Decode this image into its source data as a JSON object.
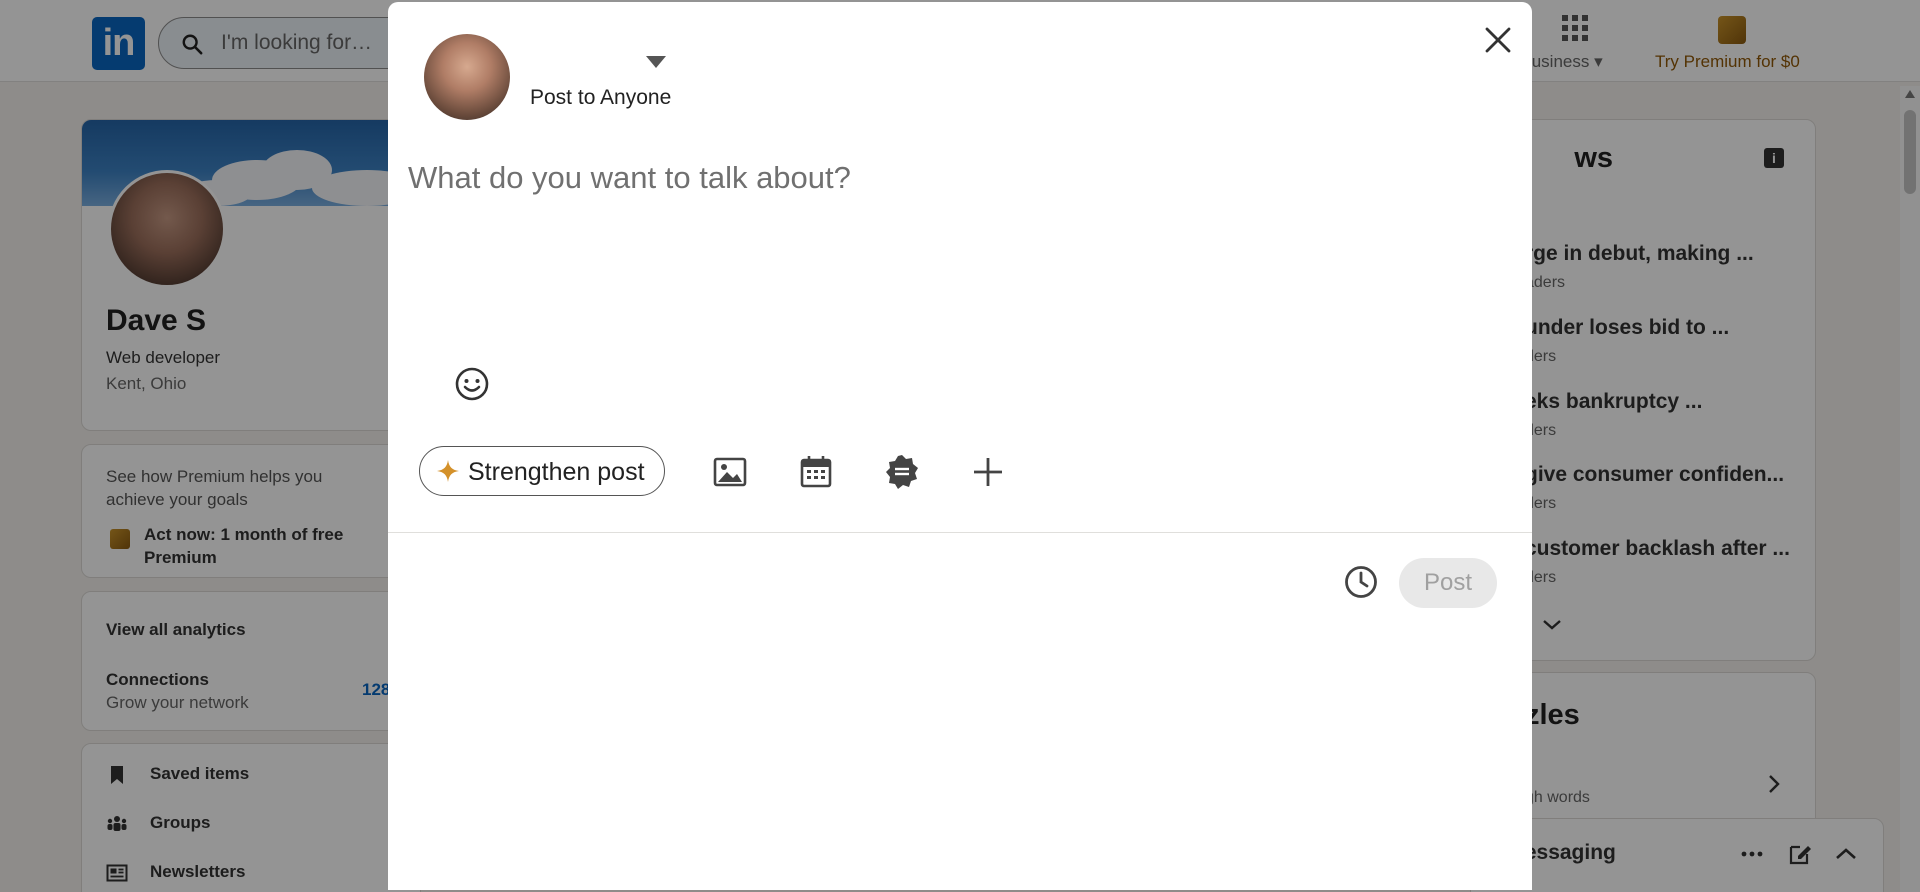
{
  "header": {
    "search_placeholder": "I'm looking for…",
    "business_label": "r Business",
    "premium_label": "Try Premium for $0"
  },
  "profile": {
    "name": "Dave S",
    "headline": "Web developer",
    "location": "Kent, Ohio"
  },
  "promo": {
    "text": "See how Premium helps you achieve your goals",
    "cta": "Act now: 1 month of free Premium"
  },
  "analytics": {
    "view_all": "View all analytics",
    "connections_label": "Connections",
    "connections_sub": "Grow your network",
    "connections_count": "128"
  },
  "nav": {
    "items": [
      {
        "label": "Saved items"
      },
      {
        "label": "Groups"
      },
      {
        "label": "Newsletters"
      }
    ]
  },
  "news": {
    "title": "ws",
    "items": [
      {
        "headline": "rge in debut, making ...",
        "readers": "aders"
      },
      {
        "headline": "under loses bid to ...",
        "readers": "ders"
      },
      {
        "headline": "eks bankruptcy ...",
        "readers": "ders"
      },
      {
        "headline": "give consumer confiden...",
        "readers": "ders"
      },
      {
        "headline": "customer backlash after ...",
        "readers": "ders"
      }
    ]
  },
  "puzzles": {
    "title": "zles",
    "subtitle": "gh words"
  },
  "messaging": {
    "label": "lessaging"
  },
  "modal": {
    "audience_label": "Post to Anyone",
    "composer_placeholder": "What do you want to talk about?",
    "strengthen_label": "Strengthen post",
    "post_label": "Post"
  },
  "colors": {
    "linkedin_blue": "#0a66c2",
    "premium_gold": "#c9932a",
    "overlay": "rgba(0,0,0,0.42)",
    "post_disabled_bg": "#e8e8e8",
    "post_disabled_text": "#a0a0a0"
  },
  "icons": {
    "emoji": "smiley-icon",
    "media": "image-icon",
    "event": "calendar-icon",
    "celebrate": "badge-icon",
    "more": "plus-icon",
    "schedule": "clock-icon",
    "close": "close-icon"
  }
}
